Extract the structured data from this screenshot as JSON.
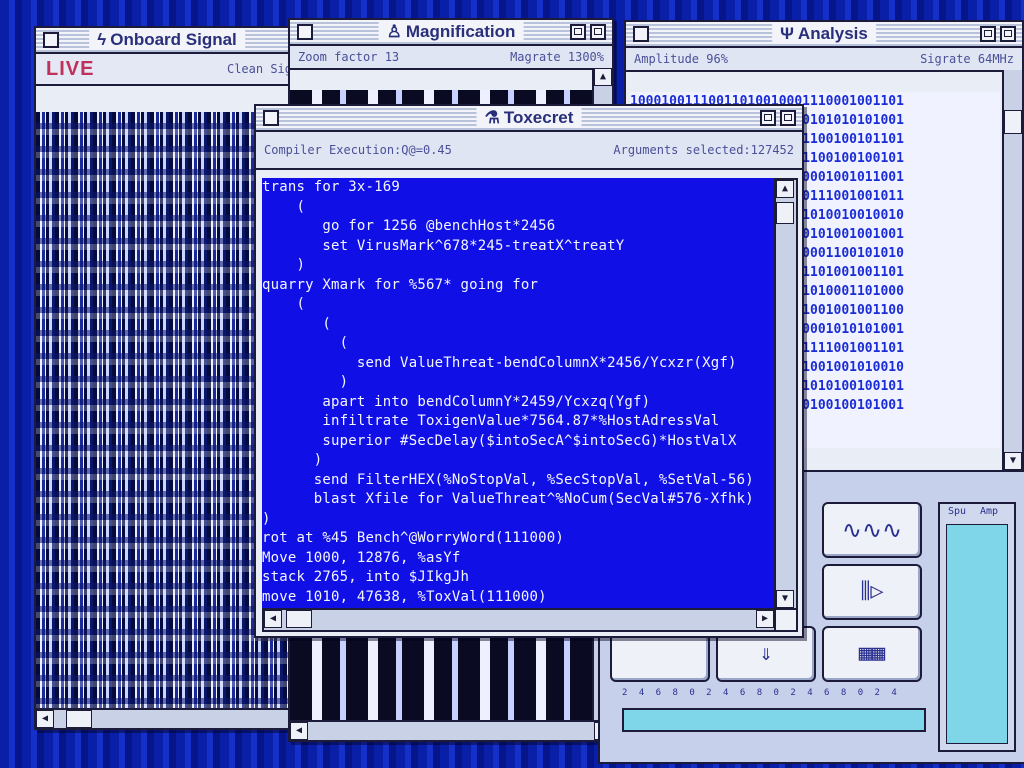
{
  "windows": {
    "onboard": {
      "title": "Onboard Signal",
      "live_label": "LIVE",
      "status_right": "Clean Sig"
    },
    "magnification": {
      "title": "Magnification",
      "zoom_label": "Zoom factor 13",
      "magrate_label": "Magrate 1300%"
    },
    "analysis": {
      "title": "Analysis",
      "amplitude_label": "Amplitude 96%",
      "sigrate_label": "Sigrate 64MHz",
      "binary_lines": [
        "10001001110011010010001110001001101",
        "01001010100101010101000101010101001",
        "10101001001010001001001100100101101",
        "00101001001110010010011100100100101",
        "10001001001100101000110001001011001",
        "10111001110100101001000111001001011",
        "11011100101001000000111010010010010",
        "10011100110101010101100101001001001",
        "10110010100100010010010001100101010",
        "01110001110010101100011101001001101",
        "10101010101001010101001010001101000",
        "10100110001001100101001001001001100",
        "00101001001010001101010001010101001",
        "11001011001001000101001111001001101",
        "10101010100100101000101001001010010",
        "11101000101010000111001010100100101",
        "10011101010101010001100100100101001"
      ]
    },
    "toxecret": {
      "title": "Toxecret",
      "compiler_status": "Compiler Execution:Q@=0.45",
      "arguments_status": "Arguments selected:127452",
      "code_lines": [
        "trans for 3x-169",
        "    (",
        "       go for 1256 @benchHost*2456",
        "       set VirusMark^678*245-treatX^treatY",
        "    )",
        "quarry Xmark for %567* going for",
        "    (",
        "       (",
        "         (",
        "           send ValueThreat-bendColumnX*2456/Ycxzr(Xgf)",
        "         )",
        "       apart into bendColumnY*2459/Ycxzq(Ygf)",
        "       infiltrate ToxigenValue*7564.87*%HostAdressVal",
        "       superior #SecDelay($intoSecA^$intoSecG)*HostValX",
        "      )",
        "      send FilterHEX(%NoStopVal, %SecStopVal, %SetVal-56)",
        "      blast Xfile for ValueThreat^%NoCum(SecVal#576-Xfhk)",
        ")",
        "rot at %45 Bench^@WorryWord(111000)",
        "Move 1000, 12876, %asYf",
        "stack 2765, into $JIkgJh",
        "move 1010, 47638, %ToxVal(111000)"
      ]
    }
  },
  "controls": {
    "meter_labels": [
      "Spu",
      "Amp"
    ],
    "slider_ticks": "2 4 6 8 0 2 4 6 8 0 2 4 6 8 0 2 4",
    "icons": [
      "wave-icon",
      "signal-arrow-icon",
      "grid-icon",
      "down-arrow-icon"
    ]
  },
  "colors": {
    "desktop_blue": "#0a1fa8",
    "code_bg": "#1010e6",
    "live_red": "#c0305a"
  }
}
